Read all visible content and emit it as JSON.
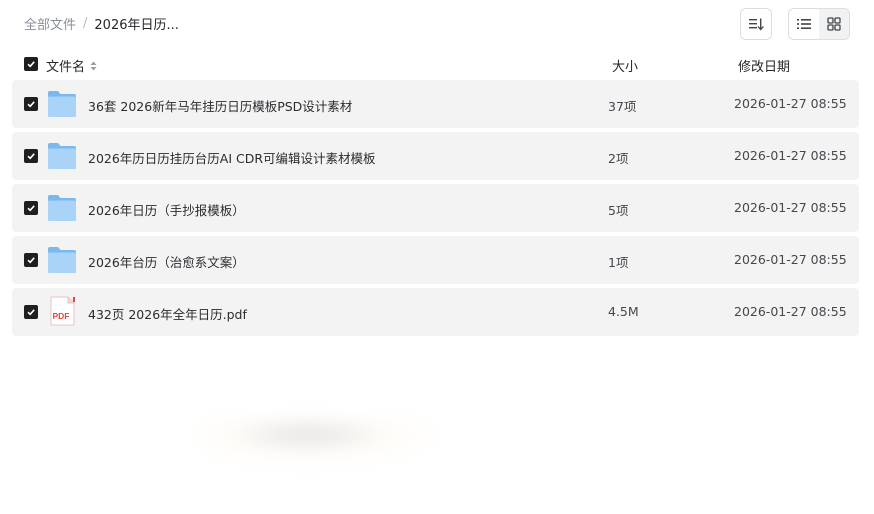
{
  "breadcrumb": {
    "root": "全部文件",
    "separator": "/",
    "current": "2026年日历..."
  },
  "toolbar": {
    "sort_icon": "sort-lines-icon",
    "list_view_icon": "list-view-icon",
    "grid_view_icon": "grid-view-icon",
    "active_view": "grid"
  },
  "columns": {
    "name": "文件名",
    "size": "大小",
    "date": "修改日期"
  },
  "files": [
    {
      "name": "36套 2026新年马年挂历日历模板PSD设计素材",
      "size": "37项",
      "date": "2026-01-27 08:55",
      "type": "folder",
      "checked": true
    },
    {
      "name": "2026年历日历挂历台历AI CDR可编辑设计素材模板",
      "size": "2项",
      "date": "2026-01-27 08:55",
      "type": "folder",
      "checked": true
    },
    {
      "name": "2026年日历（手抄报模板）",
      "size": "5项",
      "date": "2026-01-27 08:55",
      "type": "folder",
      "checked": true
    },
    {
      "name": "2026年台历（治愈系文案）",
      "size": "1项",
      "date": "2026-01-27 08:55",
      "type": "folder",
      "checked": true
    },
    {
      "name": "432页 2026年全年日历.pdf",
      "size": "4.5M",
      "date": "2026-01-27 08:55",
      "type": "pdf",
      "checked": true,
      "icon_label": "PDF"
    }
  ],
  "colors": {
    "row_bg": "#f3f3f4",
    "folder_light": "#a9d3f7",
    "folder_dark": "#7ab8ee",
    "pdf_red": "#e8453c",
    "checkbox": "#1f1f1f"
  }
}
